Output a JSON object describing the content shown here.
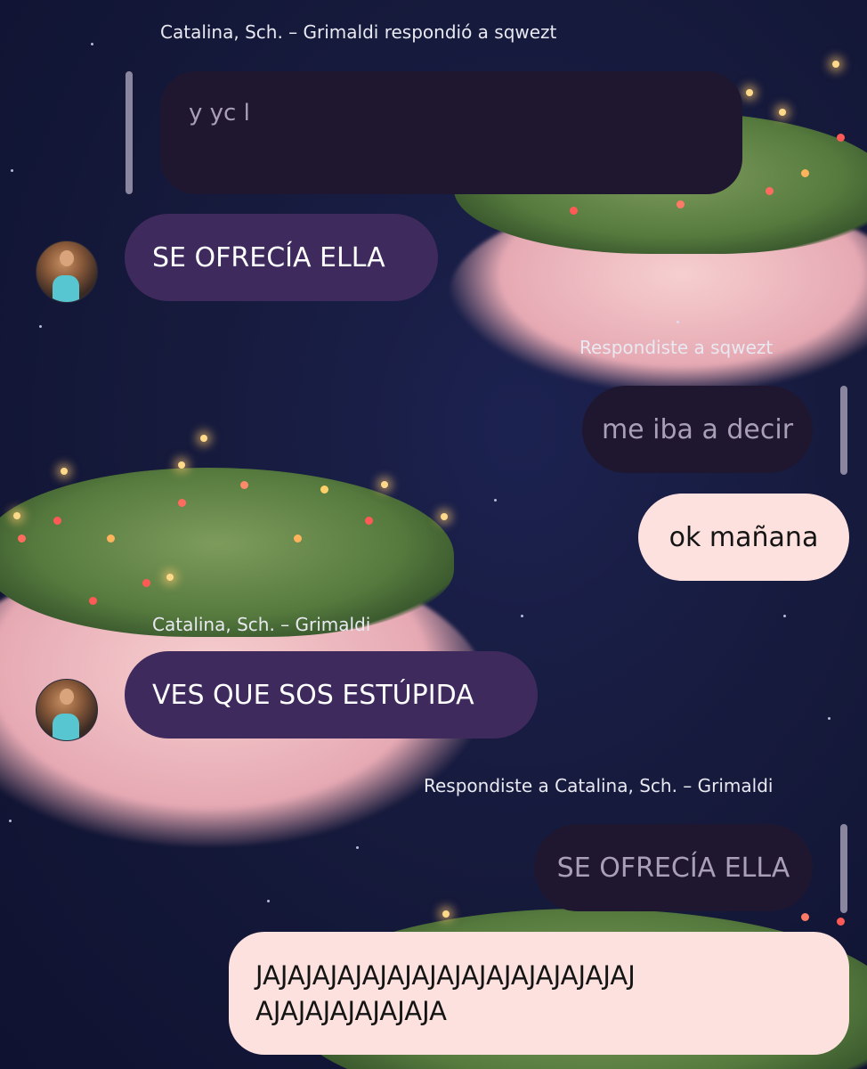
{
  "messages": [
    {
      "id": "m1",
      "sender_label": "Catalina, Sch. – Grimaldi respondió a sqwezt",
      "quoted_text": "y yc l",
      "text": "SE OFRECÍA ELLA"
    },
    {
      "id": "m2",
      "sender_label": "Respondiste a sqwezt",
      "quoted_text": "me iba a decir",
      "text": "ok mañana"
    },
    {
      "id": "m3",
      "sender_label": "Catalina, Sch. – Grimaldi",
      "text": "VES QUE SOS ESTÚPIDA"
    },
    {
      "id": "m4",
      "sender_label": "Respondiste a Catalina, Sch. – Grimaldi",
      "quoted_text": "SE OFRECÍA ELLA",
      "text_line1": "JAJAJAJAJAJAJAJAJAJAJAJAJAJAJAJ",
      "text_line2": "AJAJAJAJAJAJAJA"
    }
  ],
  "colors": {
    "incoming_bubble": "#3f2a5e",
    "outgoing_bubble": "#fde1de",
    "quoted_bubble": "#1f1730",
    "background": "#161a3c"
  }
}
